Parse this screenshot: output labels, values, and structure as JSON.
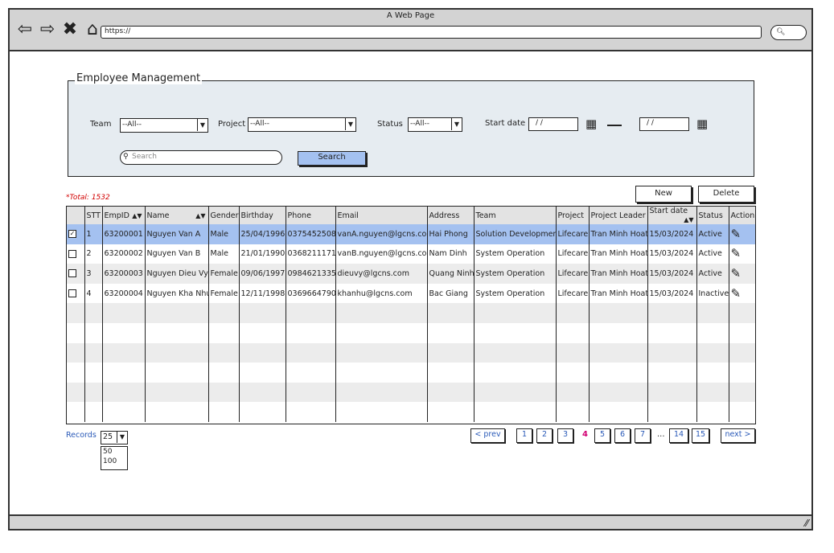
{
  "window": {
    "title": "A Web Page",
    "url": "https://"
  },
  "filter": {
    "legend": "Employee Management",
    "team_label": "Team",
    "team_value": "--All--",
    "project_label": "Project",
    "project_value": "--All--",
    "status_label": "Status",
    "status_value": "--All--",
    "startdate_label": "Start date",
    "date_from": "/ /",
    "date_to": "/ /",
    "search_placeholder": "Search",
    "search_button": "Search"
  },
  "toolbar": {
    "total": "*Total: 1532",
    "new_label": "New",
    "delete_label": "Delete"
  },
  "table": {
    "columns": [
      "",
      "STT",
      "EmpID",
      "Name",
      "Gender",
      "Birthday",
      "Phone",
      "Email",
      "Address",
      "Team",
      "Project",
      "Project Leader",
      "Start date",
      "Status",
      "Action"
    ],
    "rows": [
      {
        "checked": "✓",
        "stt": "1",
        "empid": "63200001",
        "name": "Nguyen Van A",
        "gender": "Male",
        "birthday": "25/04/1996",
        "phone": "0375452508",
        "email": "vanA.nguyen@lgcns.com",
        "address": "Hai Phong",
        "team": "Solution Development",
        "project": "Lifecare",
        "leader": "Tran Minh Hoat",
        "startdate": "15/03/2024",
        "status": "Active"
      },
      {
        "checked": "",
        "stt": "2",
        "empid": "63200002",
        "name": "Nguyen Van B",
        "gender": "Male",
        "birthday": "21/01/1990",
        "phone": "0368211171",
        "email": "vanB.nguyen@lgcns.com",
        "address": "Nam Dinh",
        "team": "System Operation",
        "project": "Lifecare",
        "leader": "Tran Minh Hoat",
        "startdate": "15/03/2024",
        "status": "Active"
      },
      {
        "checked": "",
        "stt": "3",
        "empid": "63200003",
        "name": "Nguyen Dieu Vy",
        "gender": "Female",
        "birthday": "09/06/1997",
        "phone": "0984621335",
        "email": "dieuvy@lgcns.com",
        "address": "Quang Ninh",
        "team": "System Operation",
        "project": "Lifecare",
        "leader": "Tran Minh Hoat",
        "startdate": "15/03/2024",
        "status": "Active"
      },
      {
        "checked": "",
        "stt": "4",
        "empid": "63200004",
        "name": "Nguyen Kha Nhu",
        "gender": "Female",
        "birthday": "12/11/1998",
        "phone": "0369664790",
        "email": "khanhu@lgcns.com",
        "address": "Bac Giang",
        "team": "System Operation",
        "project": "Lifecare",
        "leader": "Tran Minh Hoat",
        "startdate": "15/03/2024",
        "status": "Inactive"
      }
    ]
  },
  "records": {
    "label": "Records",
    "selected": "25",
    "options": [
      "50",
      "100"
    ]
  },
  "pagination": {
    "prev": "< prev",
    "next": "next >",
    "pages": [
      "1",
      "2",
      "3"
    ],
    "current": "4",
    "pages_after": [
      "5",
      "6",
      "7"
    ],
    "ellipsis": "...",
    "last_pages": [
      "14",
      "15"
    ]
  },
  "colors": {
    "selected_row": "#a4c1f0",
    "total_text": "#d20000",
    "current_page": "#d20073"
  }
}
